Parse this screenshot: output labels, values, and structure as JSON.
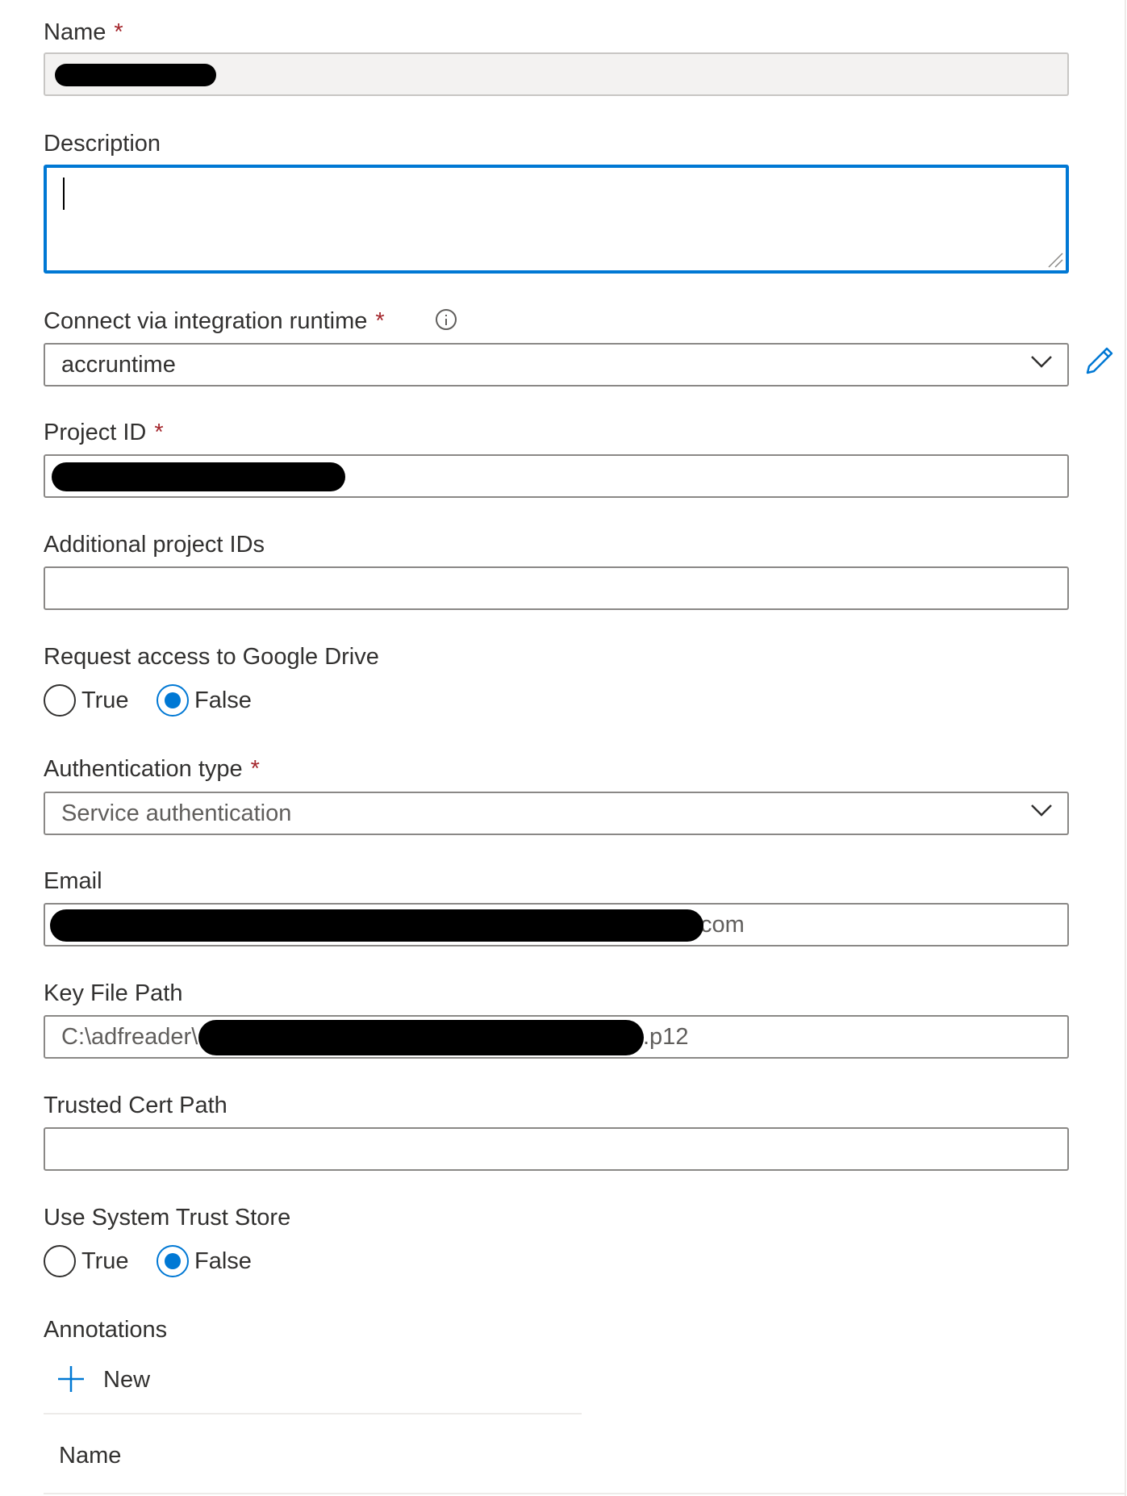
{
  "form": {
    "name": {
      "label": "Name",
      "required_mark": "*",
      "value": ""
    },
    "description": {
      "label": "Description",
      "value": ""
    },
    "integration_runtime": {
      "label": "Connect via integration runtime",
      "required_mark": "*",
      "selected": "accruntime"
    },
    "project_id": {
      "label": "Project ID",
      "required_mark": "*",
      "value": ""
    },
    "additional_project_ids": {
      "label": "Additional project IDs",
      "value": ""
    },
    "google_drive_access": {
      "label": "Request access to Google Drive",
      "options": [
        "True",
        "False"
      ],
      "selected": "False"
    },
    "authentication_type": {
      "label": "Authentication type",
      "required_mark": "*",
      "selected": "Service authentication"
    },
    "email": {
      "label": "Email",
      "visible_suffix": "com"
    },
    "key_file_path": {
      "label": "Key File Path",
      "visible_prefix": "C:\\adfreader\\",
      "visible_suffix": ".p12"
    },
    "trusted_cert_path": {
      "label": "Trusted Cert Path",
      "value": ""
    },
    "system_trust_store": {
      "label": "Use System Trust Store",
      "options": [
        "True",
        "False"
      ],
      "selected": "False"
    },
    "annotations": {
      "label": "Annotations",
      "new_button_label": "New",
      "table_header_name": "Name"
    }
  },
  "icons": {
    "info": "info-icon",
    "chevron": "chevron-down-icon",
    "edit": "pencil-icon",
    "add": "plus-icon"
  },
  "colors": {
    "accent": "#0078d4",
    "required": "#a4262c",
    "text": "#323130",
    "border": "#8a8886"
  }
}
